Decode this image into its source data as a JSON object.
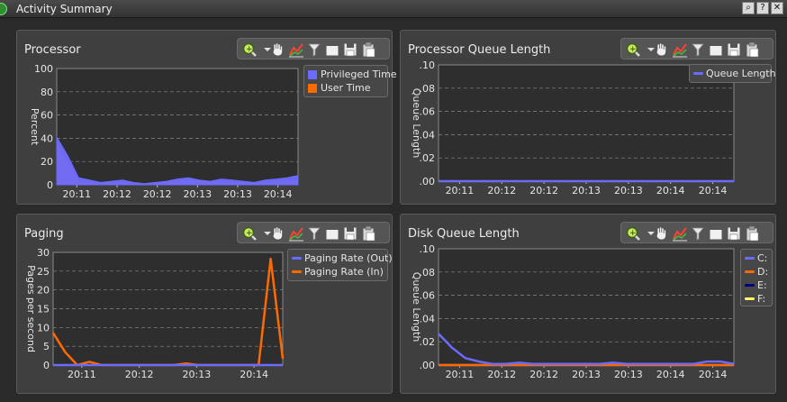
{
  "window": {
    "title": "Activity Summary",
    "buttons": [
      "zoom",
      "help",
      "close"
    ]
  },
  "panels": [
    {
      "id": "processor",
      "title": "Processor",
      "legend": [
        {
          "label": "Privileged Time",
          "color": "#6b6bff"
        },
        {
          "label": "User Time",
          "color": "#ff6a00"
        }
      ]
    },
    {
      "id": "processor-queue",
      "title": "Processor Queue Length",
      "legend": [
        {
          "label": "Queue Length",
          "color": "#6b6bff"
        }
      ]
    },
    {
      "id": "paging",
      "title": "Paging",
      "legend": [
        {
          "label": "Paging Rate (Out)",
          "color": "#6b6bff"
        },
        {
          "label": "Paging Rate (In)",
          "color": "#ff6a00"
        }
      ]
    },
    {
      "id": "disk-queue",
      "title": "Disk Queue Length",
      "legend": [
        {
          "label": "C:",
          "color": "#6b6bff"
        },
        {
          "label": "D:",
          "color": "#ff6a00"
        },
        {
          "label": "E:",
          "color": "#000080"
        },
        {
          "label": "F:",
          "color": "#ffff66"
        }
      ]
    }
  ],
  "chart_data": [
    {
      "type": "area",
      "title": "Processor",
      "xlabel": "",
      "ylabel": "Percent",
      "ylim": [
        0,
        100
      ],
      "yticks": [
        "100",
        "80",
        "60",
        "40",
        "20",
        "0"
      ],
      "xticks": [
        "20:11",
        "20:12",
        "20:12",
        "20:13",
        "20:13",
        "20:14"
      ],
      "series": [
        {
          "name": "Privileged Time",
          "color": "#6b6bff",
          "values": [
            41,
            25,
            6,
            4,
            2,
            3,
            4,
            2,
            1,
            2,
            3,
            5,
            6,
            4,
            3,
            5,
            4,
            3,
            2,
            4,
            5,
            6,
            8
          ]
        },
        {
          "name": "User Time",
          "color": "#ff6a00",
          "values": [
            36,
            20,
            3,
            2,
            1,
            2,
            2,
            1,
            0,
            1,
            2,
            3,
            4,
            3,
            2,
            3,
            2,
            2,
            1,
            2,
            3,
            3,
            4
          ]
        }
      ]
    },
    {
      "type": "line",
      "title": "Processor Queue Length",
      "xlabel": "",
      "ylabel": "Queue Length",
      "ylim": [
        0,
        0.1
      ],
      "yticks": [
        ".10",
        ".08",
        ".06",
        ".04",
        ".02",
        ".00"
      ],
      "xticks": [
        "20:11",
        "20:12",
        "20:12",
        "20:13",
        "20:13",
        "20:14",
        "20:14"
      ],
      "series": [
        {
          "name": "Queue Length",
          "color": "#6b6bff",
          "values": [
            0,
            0,
            0,
            0,
            0,
            0,
            0,
            0,
            0,
            0,
            0,
            0,
            0,
            0,
            0,
            0,
            0,
            0,
            0,
            0,
            0,
            0,
            0
          ]
        }
      ]
    },
    {
      "type": "line",
      "title": "Paging",
      "xlabel": "",
      "ylabel": "Pages per second",
      "ylim": [
        0,
        35
      ],
      "yticks": [
        "30",
        "25",
        "20",
        "15",
        "10",
        "5",
        "0"
      ],
      "xticks": [
        "20:11",
        "20:12",
        "20:13",
        "20:14"
      ],
      "series": [
        {
          "name": "Paging Rate (Out)",
          "color": "#6b6bff",
          "values": [
            0,
            0,
            0,
            0,
            0,
            0,
            0,
            0,
            0,
            0,
            0,
            0,
            0,
            0,
            0,
            0,
            0,
            0,
            0,
            0
          ]
        },
        {
          "name": "Paging Rate (In)",
          "color": "#ff6a00",
          "values": [
            10,
            4,
            0,
            1,
            0,
            0,
            0,
            0,
            0,
            0,
            0,
            0.5,
            0,
            0,
            0,
            0,
            0,
            0,
            33,
            2
          ]
        }
      ]
    },
    {
      "type": "line",
      "title": "Disk Queue Length",
      "xlabel": "",
      "ylabel": "Queue Length",
      "ylim": [
        0,
        0.1
      ],
      "yticks": [
        ".10",
        ".08",
        ".06",
        ".04",
        ".02",
        ".00"
      ],
      "xticks": [
        "20:11",
        "20:12",
        "20:12",
        "20:13",
        "20:13",
        "20:14",
        "20:14"
      ],
      "series": [
        {
          "name": "C:",
          "color": "#6b6bff",
          "values": [
            0.027,
            0.015,
            0.006,
            0.003,
            0.001,
            0.001,
            0.002,
            0.001,
            0.001,
            0.001,
            0.001,
            0.001,
            0.001,
            0.002,
            0.001,
            0.001,
            0.001,
            0.001,
            0.001,
            0.001,
            0.003,
            0.003,
            0.001
          ]
        },
        {
          "name": "D:",
          "color": "#ff6a00",
          "values": [
            0,
            0,
            0,
            0,
            0,
            0,
            0,
            0,
            0,
            0,
            0,
            0,
            0,
            0,
            0,
            0,
            0,
            0,
            0,
            0,
            0,
            0,
            0
          ]
        },
        {
          "name": "E:",
          "color": "#000080",
          "values": [
            0,
            0,
            0,
            0,
            0,
            0,
            0,
            0,
            0,
            0,
            0,
            0,
            0,
            0,
            0,
            0,
            0,
            0,
            0,
            0,
            0,
            0,
            0
          ]
        },
        {
          "name": "F:",
          "color": "#ffff66",
          "values": [
            0,
            0,
            0,
            0,
            0,
            0,
            0,
            0,
            0,
            0,
            0,
            0,
            0,
            0,
            0,
            0,
            0,
            0,
            0,
            0,
            0,
            0,
            0
          ]
        }
      ]
    }
  ]
}
